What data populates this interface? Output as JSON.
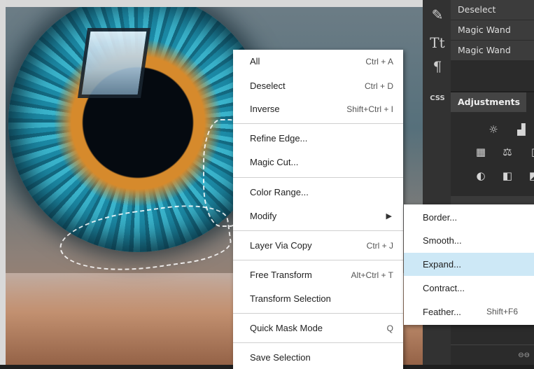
{
  "history": {
    "items": [
      "Deselect",
      "Magic Wand",
      "Magic Wand"
    ]
  },
  "toolbar": {
    "css_label": "CSS"
  },
  "adjustments": {
    "tab_label": "Adjustments"
  },
  "context_menu": {
    "items": [
      {
        "label": "All",
        "shortcut": "Ctrl + A"
      },
      {
        "label": "Deselect",
        "shortcut": "Ctrl + D"
      },
      {
        "label": "Inverse",
        "shortcut": "Shift+Ctrl + I"
      },
      {
        "label": "Refine Edge...",
        "shortcut": ""
      },
      {
        "label": "Magic Cut...",
        "shortcut": ""
      },
      {
        "label": "Color Range...",
        "shortcut": ""
      },
      {
        "label": "Modify",
        "shortcut": ""
      },
      {
        "label": "Layer Via Copy",
        "shortcut": "Ctrl + J"
      },
      {
        "label": "Free Transform",
        "shortcut": "Alt+Ctrl + T"
      },
      {
        "label": "Transform Selection",
        "shortcut": ""
      },
      {
        "label": "Quick Mask Mode",
        "shortcut": "Q"
      },
      {
        "label": "Save Selection",
        "shortcut": ""
      }
    ]
  },
  "submenu": {
    "items": [
      {
        "label": "Border...",
        "shortcut": ""
      },
      {
        "label": "Smooth...",
        "shortcut": ""
      },
      {
        "label": "Expand...",
        "shortcut": ""
      },
      {
        "label": "Contract...",
        "shortcut": ""
      },
      {
        "label": "Feather...",
        "shortcut": "Shift+F6"
      }
    ],
    "highlighted": "Expand..."
  },
  "colors": {
    "menu_bg": "#ffffff",
    "highlight": "#cde8f6",
    "panel_bg": "#2b2b2b"
  }
}
